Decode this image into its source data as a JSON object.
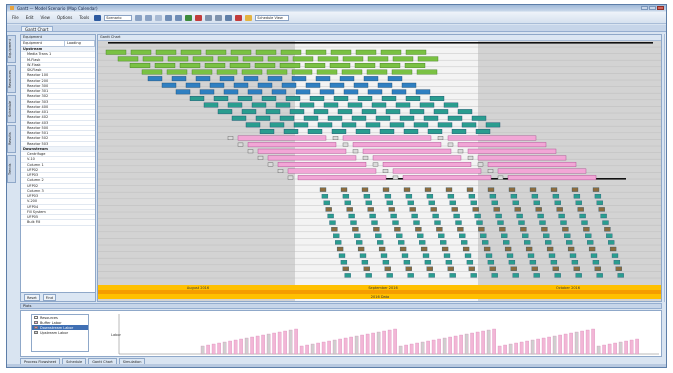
{
  "window": {
    "title": "Gantt — Model Scenario (Map Calendar)"
  },
  "menu": {
    "items": [
      "File",
      "Edit",
      "View",
      "Options",
      "Tools"
    ],
    "scenario_select": "Scenario",
    "right_select": "Schedule View"
  },
  "subtab_label": "Gantt Chart",
  "side_tabs": [
    "Equipment",
    "Resources",
    "Schedule",
    "Results",
    "Trends"
  ],
  "left_panel": {
    "header": "Equipment",
    "columns": [
      "Equipment",
      "Loading"
    ],
    "rows": [
      {
        "label": "Upstream",
        "group": true
      },
      {
        "label": "Media Trans 1",
        "group": false
      },
      {
        "label": "M-Flask",
        "group": false
      },
      {
        "label": "W-Flask",
        "group": false
      },
      {
        "label": "SK-Flask",
        "group": false
      },
      {
        "label": "Reactor 100",
        "group": false
      },
      {
        "label": "Reactor 200",
        "group": false
      },
      {
        "label": "Reactor 300",
        "group": false
      },
      {
        "label": "Reactor 301",
        "group": false
      },
      {
        "label": "Reactor 302",
        "group": false
      },
      {
        "label": "Reactor 303",
        "group": false
      },
      {
        "label": "Reactor 400",
        "group": false
      },
      {
        "label": "Reactor 401",
        "group": false
      },
      {
        "label": "Reactor 402",
        "group": false
      },
      {
        "label": "Reactor 403",
        "group": false
      },
      {
        "label": "Reactor 500",
        "group": false
      },
      {
        "label": "Reactor 501",
        "group": false
      },
      {
        "label": "Reactor 502",
        "group": false
      },
      {
        "label": "Reactor 503",
        "group": false
      },
      {
        "label": "Downstream",
        "group": true
      },
      {
        "label": "Centrifuge",
        "group": false
      },
      {
        "label": "V-10",
        "group": false
      },
      {
        "label": "Column 1",
        "group": false
      },
      {
        "label": "UFP02",
        "group": false
      },
      {
        "label": "UFP03",
        "group": false
      },
      {
        "label": "Column 2",
        "group": false
      },
      {
        "label": "UFP02",
        "group": false
      },
      {
        "label": "Column 3",
        "group": false
      },
      {
        "label": "UFP03",
        "group": false
      },
      {
        "label": "V-200",
        "group": false
      },
      {
        "label": "UFP04",
        "group": false
      },
      {
        "label": "Fill System",
        "group": false
      },
      {
        "label": "UFP05",
        "group": false
      },
      {
        "label": "Bulk Fill",
        "group": false
      }
    ],
    "footer_buttons": [
      "Reset",
      "Find"
    ]
  },
  "gantt": {
    "header": "Gantt Chart",
    "months": [
      "August 2016",
      "September 2016",
      "October 2016"
    ],
    "axis_caption": "2016 Data"
  },
  "plots": {
    "bar_label": "Plots",
    "legend": [
      {
        "label": "Resources",
        "color": "#ffffff",
        "selected": false
      },
      {
        "label": "Buffer Labor",
        "color": "#f2b6d6",
        "selected": false
      },
      {
        "label": "Downstream Labor",
        "color": "#e07ab0",
        "selected": true
      },
      {
        "label": "Upstream Labor",
        "color": "#cfcfcf",
        "selected": false
      }
    ],
    "y_label": "Labor"
  },
  "bottom_tabs": [
    "Process Flowsheet",
    "Schedule",
    "Gantt Chart",
    "Simulation"
  ],
  "colors": {
    "upstream_green": "#7ac143",
    "reactor_blue": "#2f7fc1",
    "task_teal": "#2a9d8f",
    "pink_bar": "#f2a6d6",
    "timeline_yellow": "#ffc000",
    "timeline_orange": "#f59d00",
    "gantt_bg": "#d3d3d3",
    "highlight_band": "#f3f3f3"
  }
}
